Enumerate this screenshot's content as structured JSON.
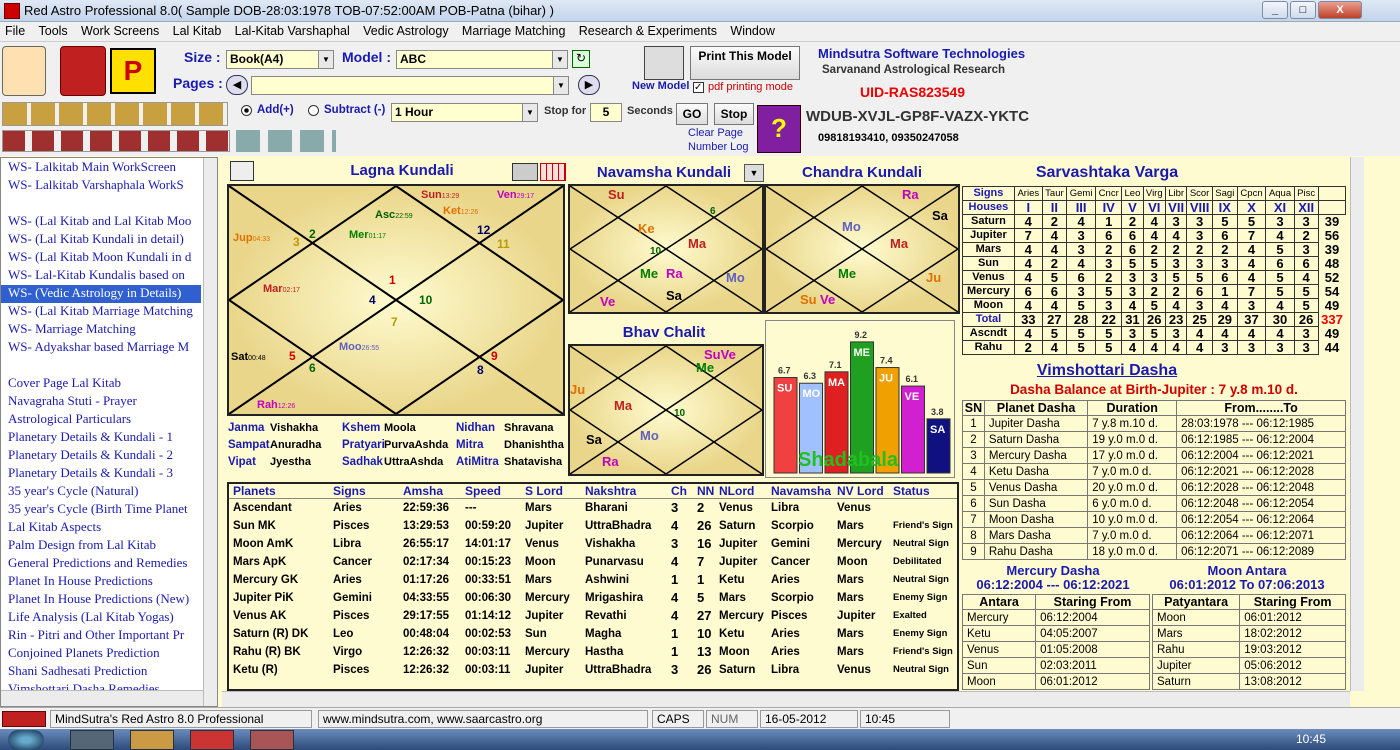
{
  "window": {
    "title": "Red Astro Professional 8.0( Sample DOB-28:03:1978 TOB-07:52:00AM POB-Patna (bihar) )",
    "btn_min": "_",
    "btn_max": "□",
    "btn_close": "X"
  },
  "menu": [
    "File",
    "Tools",
    "Work Screens",
    "Lal Kitab",
    "Lal-Kitab Varshaphal",
    "Vedic Astrology",
    "Marriage Matching",
    "Research & Experiments",
    "Window"
  ],
  "toolbar": {
    "size_label": "Size :",
    "size_value": "Book(A4)",
    "model_label": "Model :",
    "model_value": "ABC",
    "pages_label": "Pages :",
    "new_model": "New Model",
    "print_model": "Print This Model",
    "pdf_mode": "pdf printing mode",
    "add": "Add(+)",
    "subtract": "Subtract (-)",
    "interval": "1 Hour",
    "stop_for": "Stop for",
    "stop_value": "5",
    "seconds": "Seconds",
    "go": "GO",
    "stop": "Stop",
    "clear_page": "Clear Page",
    "number_log": "Number Log"
  },
  "company": {
    "name": "Mindsutra Software Technologies",
    "sub": "Sarvanand Astrological Research",
    "uid": "UID-RAS823549",
    "key": "WDUB-XVJL-GP8F-VAZX-YKTC",
    "phone": "09818193410, 09350247058"
  },
  "left_items": [
    "WS- Lalkitab Main WorkScreen",
    "WS- Lalkitab Varshaphala WorkS",
    "",
    "WS- (Lal Kitab and Lal Kitab Moo",
    "WS- (Lal Kitab Kundali in detail)",
    "WS- (Lal Kitab Moon Kundali in d",
    "WS- Lal-Kitab Kundalis based on",
    "WS- (Vedic Astrology in Details)",
    "WS- (Lal Kitab Marriage Matching",
    "WS- Marriage Matching",
    "WS- Adyakshar based Marriage M",
    "",
    "Cover Page Lal Kitab",
    "Navagraha Stuti - Prayer",
    "Astrological Particulars",
    "Planetary Details & Kundali - 1",
    "Planetary Details & Kundali - 2",
    "Planetary Details & Kundali - 3",
    "35 year's Cycle (Natural)",
    "35 year's Cycle (Birth Time Planet",
    "Lal Kitab Aspects",
    "Palm Design from Lal Kitab",
    "General Predictions and Remedies",
    "Planet In House Predictions",
    "Planet In House Predictions (New)",
    "Life Analysis (Lal Kitab Yogas)",
    "Rin - Pitri and Other Important Pr",
    "Conjoined Planets Prediction",
    "Shani Sadhesati Prediction",
    "Vimshottari Dasha Remedies"
  ],
  "lagna": {
    "title": "Lagna Kundali",
    "labels": [
      {
        "t": "Sun",
        "s": "13:29",
        "c": "#c02020"
      },
      {
        "t": "Ven",
        "s": "29:17",
        "c": "#c000c0"
      },
      {
        "t": "Ket",
        "s": "12:26",
        "c": "#e07000"
      },
      {
        "t": "Asc",
        "s": "22:59",
        "c": "#006000"
      },
      {
        "t": "Mer",
        "s": "01:17",
        "c": "#008000"
      },
      {
        "t": "Jup",
        "s": "04:33",
        "c": "#e07000"
      },
      {
        "t": "Mar",
        "s": "02:17",
        "c": "#c02020"
      },
      {
        "t": "Sat",
        "s": "00:48",
        "c": "#000"
      },
      {
        "t": "Moo",
        "s": "26:55",
        "c": "#6060c0"
      },
      {
        "t": "Rah",
        "s": "12:26",
        "c": "#c000c0"
      }
    ],
    "nums": [
      "1",
      "2",
      "3",
      "4",
      "5",
      "6",
      "7",
      "8",
      "9",
      "10",
      "11",
      "12"
    ]
  },
  "nak": [
    [
      "Janma",
      "Vishakha"
    ],
    [
      "Kshem",
      "Moola"
    ],
    [
      "Nidhan",
      "Shravana"
    ],
    [
      "Sampat",
      "Anuradha"
    ],
    [
      "Pratyari",
      "PurvaAshda"
    ],
    [
      "Mitra",
      "Dhanishtha"
    ],
    [
      "Vipat",
      "Jyestha"
    ],
    [
      "Sadhak",
      "UttraAshda"
    ],
    [
      "AtiMitra",
      "Shatavisha"
    ]
  ],
  "navamsha": {
    "title": "Navamsha Kundali"
  },
  "chandra": {
    "title": "Chandra Kundali"
  },
  "bhav": {
    "title": "Bhav Chalit"
  },
  "shadbala": {
    "title": "Shadabala",
    "bars": [
      {
        "p": "SU",
        "v": 6.7,
        "c": "#f04040"
      },
      {
        "p": "MO",
        "v": 6.3,
        "c": "#a0c0ff"
      },
      {
        "p": "MA",
        "v": 7.1,
        "c": "#e02020"
      },
      {
        "p": "ME",
        "v": 9.2,
        "c": "#20a020"
      },
      {
        "p": "JU",
        "v": 7.4,
        "c": "#f0a000"
      },
      {
        "p": "VE",
        "v": 6.1,
        "c": "#d020d0"
      },
      {
        "p": "SA",
        "v": 3.8,
        "c": "#101080"
      }
    ]
  },
  "sav": {
    "title": "Sarvashtaka Varga",
    "signs": [
      "Aries",
      "Taur",
      "Gemi",
      "Cncr",
      "Leo",
      "Virg",
      "Libr",
      "Scor",
      "Sagi",
      "Cpcn",
      "Aqua",
      "Pisc"
    ],
    "houses": [
      "I",
      "II",
      "III",
      "IV",
      "V",
      "VI",
      "VII",
      "VIII",
      "IX",
      "X",
      "XI",
      "XII"
    ],
    "rows": [
      {
        "n": "Saturn",
        "v": [
          "4",
          "2",
          "4",
          "1",
          "2",
          "4",
          "3",
          "3",
          "5",
          "5",
          "3",
          "3",
          "39"
        ]
      },
      {
        "n": "Jupiter",
        "v": [
          "7",
          "4",
          "3",
          "6",
          "6",
          "4",
          "4",
          "3",
          "6",
          "7",
          "4",
          "2",
          "56"
        ]
      },
      {
        "n": "Mars",
        "v": [
          "4",
          "4",
          "3",
          "2",
          "6",
          "2",
          "2",
          "2",
          "2",
          "4",
          "5",
          "3",
          "39"
        ]
      },
      {
        "n": "Sun",
        "v": [
          "4",
          "2",
          "4",
          "3",
          "5",
          "5",
          "3",
          "3",
          "3",
          "4",
          "6",
          "6",
          "48"
        ]
      },
      {
        "n": "Venus",
        "v": [
          "4",
          "5",
          "6",
          "2",
          "3",
          "3",
          "5",
          "5",
          "6",
          "4",
          "5",
          "4",
          "52"
        ]
      },
      {
        "n": "Mercury",
        "v": [
          "6",
          "6",
          "3",
          "5",
          "3",
          "2",
          "2",
          "6",
          "1",
          "7",
          "5",
          "5",
          "54"
        ]
      },
      {
        "n": "Moon",
        "v": [
          "4",
          "4",
          "5",
          "3",
          "4",
          "5",
          "4",
          "3",
          "4",
          "3",
          "4",
          "5",
          "49"
        ]
      },
      {
        "n": "Total",
        "v": [
          "33",
          "27",
          "28",
          "22",
          "31",
          "26",
          "23",
          "25",
          "29",
          "37",
          "30",
          "26",
          "337"
        ]
      },
      {
        "n": "Ascndt",
        "v": [
          "4",
          "5",
          "5",
          "5",
          "3",
          "5",
          "3",
          "4",
          "4",
          "4",
          "4",
          "3",
          "49"
        ]
      },
      {
        "n": "Rahu",
        "v": [
          "2",
          "4",
          "5",
          "5",
          "4",
          "4",
          "4",
          "4",
          "3",
          "3",
          "3",
          "3",
          "44"
        ]
      }
    ],
    "signs_label": "Signs",
    "houses_label": "Houses"
  },
  "planets": {
    "headers": [
      "Planets",
      "Signs",
      "Amsha",
      "Speed",
      "S Lord",
      "Nakshtra",
      "Ch",
      "NN",
      "NLord",
      "Navamsha",
      "NV Lord",
      "Status"
    ],
    "rows": [
      [
        "Ascendant",
        "Aries",
        "22:59:36",
        "---",
        "Mars",
        "Bharani",
        "3",
        "2",
        "Venus",
        "Libra",
        "Venus",
        ""
      ],
      [
        "Sun MK",
        "Pisces",
        "13:29:53",
        "00:59:20",
        "Jupiter",
        "UttraBhadra",
        "4",
        "26",
        "Saturn",
        "Scorpio",
        "Mars",
        "Friend's Sign"
      ],
      [
        "Moon AmK",
        "Libra",
        "26:55:17",
        "14:01:17",
        "Venus",
        "Vishakha",
        "3",
        "16",
        "Jupiter",
        "Gemini",
        "Mercury",
        "Neutral Sign"
      ],
      [
        "Mars ApK",
        "Cancer",
        "02:17:34",
        "00:15:23",
        "Moon",
        "Punarvasu",
        "4",
        "7",
        "Jupiter",
        "Cancer",
        "Moon",
        "Debilitated"
      ],
      [
        "Mercury GK",
        "Aries",
        "01:17:26",
        "00:33:51",
        "Mars",
        "Ashwini",
        "1",
        "1",
        "Ketu",
        "Aries",
        "Mars",
        "Neutral Sign"
      ],
      [
        "Jupiter PiK",
        "Gemini",
        "04:33:55",
        "00:06:30",
        "Mercury",
        "Mrigashira",
        "4",
        "5",
        "Mars",
        "Scorpio",
        "Mars",
        "Enemy Sign"
      ],
      [
        "Venus AK",
        "Pisces",
        "29:17:55",
        "01:14:12",
        "Jupiter",
        "Revathi",
        "4",
        "27",
        "Mercury",
        "Pisces",
        "Jupiter",
        "Exalted"
      ],
      [
        "Saturn (R) DK",
        "Leo",
        "00:48:04",
        "00:02:53",
        "Sun",
        "Magha",
        "1",
        "10",
        "Ketu",
        "Aries",
        "Mars",
        "Enemy Sign"
      ],
      [
        "Rahu (R) BK",
        "Virgo",
        "12:26:32",
        "00:03:11",
        "Mercury",
        "Hastha",
        "1",
        "13",
        "Moon",
        "Aries",
        "Mars",
        "Friend's Sign"
      ],
      [
        "Ketu (R)",
        "Pisces",
        "12:26:32",
        "00:03:11",
        "Jupiter",
        "UttraBhadra",
        "3",
        "26",
        "Saturn",
        "Libra",
        "Venus",
        "Neutral Sign"
      ]
    ]
  },
  "vim": {
    "title": "Vimshottari Dasha",
    "balance": "Dasha Balance at Birth-Jupiter : 7 y.8 m.10 d.",
    "headers": [
      "SN",
      "Planet Dasha",
      "Duration",
      "From........To"
    ],
    "rows": [
      [
        "1",
        "Jupiter Dasha",
        "7 y.8 m.10 d.",
        "28:03:1978 --- 06:12:1985"
      ],
      [
        "2",
        "Saturn Dasha",
        "19 y.0 m.0 d.",
        "06:12:1985 --- 06:12:2004"
      ],
      [
        "3",
        "Mercury Dasha",
        "17 y.0 m.0 d.",
        "06:12:2004 --- 06:12:2021"
      ],
      [
        "4",
        "Ketu Dasha",
        "7 y.0 m.0 d.",
        "06:12:2021 --- 06:12:2028"
      ],
      [
        "5",
        "Venus Dasha",
        "20 y.0 m.0 d.",
        "06:12:2028 --- 06:12:2048"
      ],
      [
        "6",
        "Sun Dasha",
        "6 y.0 m.0 d.",
        "06:12:2048 --- 06:12:2054"
      ],
      [
        "7",
        "Moon Dasha",
        "10 y.0 m.0 d.",
        "06:12:2054 --- 06:12:2064"
      ],
      [
        "8",
        "Mars Dasha",
        "7 y.0 m.0 d.",
        "06:12:2064 --- 06:12:2071"
      ],
      [
        "9",
        "Rahu Dasha",
        "18 y.0 m.0 d.",
        "06:12:2071 --- 06:12:2089"
      ]
    ]
  },
  "mercury_dasha": {
    "title": "Mercury Dasha",
    "range": "06:12:2004 --- 06:12:2021",
    "h1": "Antara",
    "h2": "Staring From",
    "rows": [
      [
        "Mercury",
        "06:12:2004"
      ],
      [
        "Ketu",
        "04:05:2007"
      ],
      [
        "Venus",
        "01:05:2008"
      ],
      [
        "Sun",
        "02:03:2011"
      ],
      [
        "Moon",
        "06:01:2012"
      ]
    ]
  },
  "moon_antara": {
    "title": "Moon Antara",
    "range": "06:01:2012  To  07:06:2013",
    "h1": "Patyantara",
    "h2": "Staring From",
    "rows": [
      [
        "Moon",
        "06:01:2012"
      ],
      [
        "Mars",
        "18:02:2012"
      ],
      [
        "Rahu",
        "19:03:2012"
      ],
      [
        "Jupiter",
        "05:06:2012"
      ],
      [
        "Saturn",
        "13:08:2012"
      ]
    ]
  },
  "status": {
    "app": "MindSutra's Red Astro 8.0 Professional",
    "web": "www.mindsutra.com, www.saarcastro.org",
    "caps": "CAPS",
    "num": "NUM",
    "date": "16-05-2012",
    "time": "10:45"
  },
  "taskbar": {
    "clock": "10:45"
  }
}
